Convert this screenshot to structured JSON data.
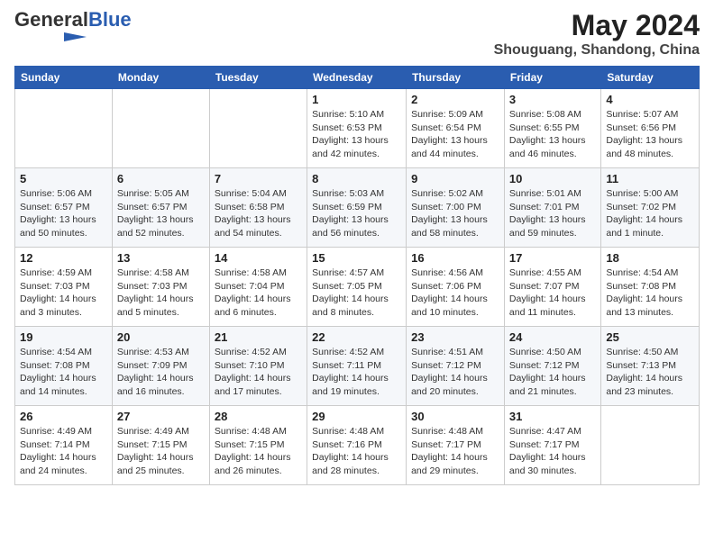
{
  "logo": {
    "general": "General",
    "blue": "Blue"
  },
  "title": "May 2024",
  "location": "Shouguang, Shandong, China",
  "weekdays": [
    "Sunday",
    "Monday",
    "Tuesday",
    "Wednesday",
    "Thursday",
    "Friday",
    "Saturday"
  ],
  "weeks": [
    [
      {
        "day": "",
        "sunrise": "",
        "sunset": "",
        "daylight": ""
      },
      {
        "day": "",
        "sunrise": "",
        "sunset": "",
        "daylight": ""
      },
      {
        "day": "",
        "sunrise": "",
        "sunset": "",
        "daylight": ""
      },
      {
        "day": "1",
        "sunrise": "Sunrise: 5:10 AM",
        "sunset": "Sunset: 6:53 PM",
        "daylight": "Daylight: 13 hours and 42 minutes."
      },
      {
        "day": "2",
        "sunrise": "Sunrise: 5:09 AM",
        "sunset": "Sunset: 6:54 PM",
        "daylight": "Daylight: 13 hours and 44 minutes."
      },
      {
        "day": "3",
        "sunrise": "Sunrise: 5:08 AM",
        "sunset": "Sunset: 6:55 PM",
        "daylight": "Daylight: 13 hours and 46 minutes."
      },
      {
        "day": "4",
        "sunrise": "Sunrise: 5:07 AM",
        "sunset": "Sunset: 6:56 PM",
        "daylight": "Daylight: 13 hours and 48 minutes."
      }
    ],
    [
      {
        "day": "5",
        "sunrise": "Sunrise: 5:06 AM",
        "sunset": "Sunset: 6:57 PM",
        "daylight": "Daylight: 13 hours and 50 minutes."
      },
      {
        "day": "6",
        "sunrise": "Sunrise: 5:05 AM",
        "sunset": "Sunset: 6:57 PM",
        "daylight": "Daylight: 13 hours and 52 minutes."
      },
      {
        "day": "7",
        "sunrise": "Sunrise: 5:04 AM",
        "sunset": "Sunset: 6:58 PM",
        "daylight": "Daylight: 13 hours and 54 minutes."
      },
      {
        "day": "8",
        "sunrise": "Sunrise: 5:03 AM",
        "sunset": "Sunset: 6:59 PM",
        "daylight": "Daylight: 13 hours and 56 minutes."
      },
      {
        "day": "9",
        "sunrise": "Sunrise: 5:02 AM",
        "sunset": "Sunset: 7:00 PM",
        "daylight": "Daylight: 13 hours and 58 minutes."
      },
      {
        "day": "10",
        "sunrise": "Sunrise: 5:01 AM",
        "sunset": "Sunset: 7:01 PM",
        "daylight": "Daylight: 13 hours and 59 minutes."
      },
      {
        "day": "11",
        "sunrise": "Sunrise: 5:00 AM",
        "sunset": "Sunset: 7:02 PM",
        "daylight": "Daylight: 14 hours and 1 minute."
      }
    ],
    [
      {
        "day": "12",
        "sunrise": "Sunrise: 4:59 AM",
        "sunset": "Sunset: 7:03 PM",
        "daylight": "Daylight: 14 hours and 3 minutes."
      },
      {
        "day": "13",
        "sunrise": "Sunrise: 4:58 AM",
        "sunset": "Sunset: 7:03 PM",
        "daylight": "Daylight: 14 hours and 5 minutes."
      },
      {
        "day": "14",
        "sunrise": "Sunrise: 4:58 AM",
        "sunset": "Sunset: 7:04 PM",
        "daylight": "Daylight: 14 hours and 6 minutes."
      },
      {
        "day": "15",
        "sunrise": "Sunrise: 4:57 AM",
        "sunset": "Sunset: 7:05 PM",
        "daylight": "Daylight: 14 hours and 8 minutes."
      },
      {
        "day": "16",
        "sunrise": "Sunrise: 4:56 AM",
        "sunset": "Sunset: 7:06 PM",
        "daylight": "Daylight: 14 hours and 10 minutes."
      },
      {
        "day": "17",
        "sunrise": "Sunrise: 4:55 AM",
        "sunset": "Sunset: 7:07 PM",
        "daylight": "Daylight: 14 hours and 11 minutes."
      },
      {
        "day": "18",
        "sunrise": "Sunrise: 4:54 AM",
        "sunset": "Sunset: 7:08 PM",
        "daylight": "Daylight: 14 hours and 13 minutes."
      }
    ],
    [
      {
        "day": "19",
        "sunrise": "Sunrise: 4:54 AM",
        "sunset": "Sunset: 7:08 PM",
        "daylight": "Daylight: 14 hours and 14 minutes."
      },
      {
        "day": "20",
        "sunrise": "Sunrise: 4:53 AM",
        "sunset": "Sunset: 7:09 PM",
        "daylight": "Daylight: 14 hours and 16 minutes."
      },
      {
        "day": "21",
        "sunrise": "Sunrise: 4:52 AM",
        "sunset": "Sunset: 7:10 PM",
        "daylight": "Daylight: 14 hours and 17 minutes."
      },
      {
        "day": "22",
        "sunrise": "Sunrise: 4:52 AM",
        "sunset": "Sunset: 7:11 PM",
        "daylight": "Daylight: 14 hours and 19 minutes."
      },
      {
        "day": "23",
        "sunrise": "Sunrise: 4:51 AM",
        "sunset": "Sunset: 7:12 PM",
        "daylight": "Daylight: 14 hours and 20 minutes."
      },
      {
        "day": "24",
        "sunrise": "Sunrise: 4:50 AM",
        "sunset": "Sunset: 7:12 PM",
        "daylight": "Daylight: 14 hours and 21 minutes."
      },
      {
        "day": "25",
        "sunrise": "Sunrise: 4:50 AM",
        "sunset": "Sunset: 7:13 PM",
        "daylight": "Daylight: 14 hours and 23 minutes."
      }
    ],
    [
      {
        "day": "26",
        "sunrise": "Sunrise: 4:49 AM",
        "sunset": "Sunset: 7:14 PM",
        "daylight": "Daylight: 14 hours and 24 minutes."
      },
      {
        "day": "27",
        "sunrise": "Sunrise: 4:49 AM",
        "sunset": "Sunset: 7:15 PM",
        "daylight": "Daylight: 14 hours and 25 minutes."
      },
      {
        "day": "28",
        "sunrise": "Sunrise: 4:48 AM",
        "sunset": "Sunset: 7:15 PM",
        "daylight": "Daylight: 14 hours and 26 minutes."
      },
      {
        "day": "29",
        "sunrise": "Sunrise: 4:48 AM",
        "sunset": "Sunset: 7:16 PM",
        "daylight": "Daylight: 14 hours and 28 minutes."
      },
      {
        "day": "30",
        "sunrise": "Sunrise: 4:48 AM",
        "sunset": "Sunset: 7:17 PM",
        "daylight": "Daylight: 14 hours and 29 minutes."
      },
      {
        "day": "31",
        "sunrise": "Sunrise: 4:47 AM",
        "sunset": "Sunset: 7:17 PM",
        "daylight": "Daylight: 14 hours and 30 minutes."
      },
      {
        "day": "",
        "sunrise": "",
        "sunset": "",
        "daylight": ""
      }
    ]
  ]
}
